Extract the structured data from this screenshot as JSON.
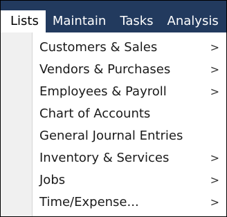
{
  "menubar": {
    "items": [
      {
        "label": "Lists"
      },
      {
        "label": "Maintain"
      },
      {
        "label": "Tasks"
      },
      {
        "label": "Analysis"
      }
    ]
  },
  "lists_menu": {
    "items": [
      {
        "label": "Customers & Sales",
        "arrow": ">"
      },
      {
        "label": "Vendors & Purchases",
        "arrow": ">"
      },
      {
        "label": "Employees & Payroll",
        "arrow": ">"
      },
      {
        "label": "Chart of Accounts"
      },
      {
        "label": "General Journal Entries"
      },
      {
        "label": "Inventory & Services",
        "arrow": ">"
      },
      {
        "label": "Jobs",
        "arrow": ">"
      },
      {
        "label": "Time/Expense...",
        "arrow": ">"
      }
    ]
  }
}
